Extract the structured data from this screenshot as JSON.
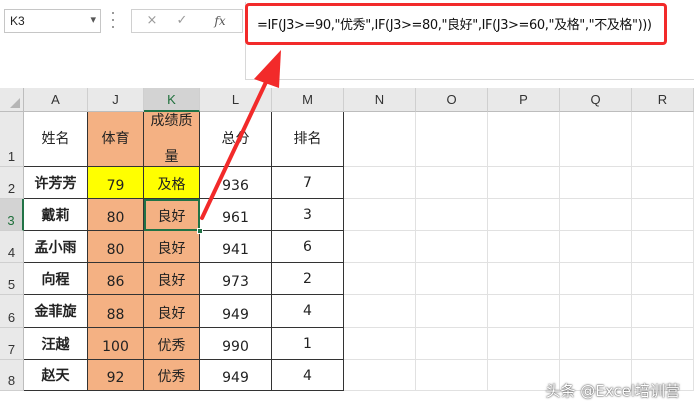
{
  "name_box": {
    "value": "K3",
    "dropdown_icon": "chevron-down-icon"
  },
  "formula_bar": {
    "cancel_icon": "×",
    "enter_icon": "✓",
    "fx_label": "fx",
    "formula": "=IF(J3>=90,\"优秀\",IF(J3>=80,\"良好\",IF(J3>=60,\"及格\",\"不及格\")))"
  },
  "columns": [
    "A",
    "J",
    "K",
    "L",
    "M",
    "N",
    "O",
    "P",
    "Q",
    "R"
  ],
  "selected_column": "K",
  "rows": [
    "1",
    "2",
    "3",
    "4",
    "5",
    "6",
    "7",
    "8"
  ],
  "selected_row": "3",
  "table": {
    "headers": [
      "姓名",
      "体育",
      "成绩质量",
      "总分",
      "排名"
    ],
    "header_display": [
      "姓名",
      "体育",
      "成绩质\n量",
      "总分",
      "排名"
    ],
    "records": [
      [
        "许芳芳",
        "79",
        "及格",
        "936",
        "7"
      ],
      [
        "戴莉",
        "80",
        "良好",
        "961",
        "3"
      ],
      [
        "孟小雨",
        "80",
        "良好",
        "941",
        "6"
      ],
      [
        "向程",
        "86",
        "良好",
        "973",
        "2"
      ],
      [
        "金菲旋",
        "88",
        "良好",
        "949",
        "4"
      ],
      [
        "汪越",
        "100",
        "优秀",
        "990",
        "1"
      ],
      [
        "赵天",
        "92",
        "优秀",
        "949",
        "4"
      ]
    ]
  },
  "colors": {
    "highlight_orange": "#f4b183",
    "highlight_yellow": "#ffff00",
    "annotation_red": "#f22a2a",
    "selection_green": "#217346"
  },
  "watermark": "头条 @Excel培训营"
}
